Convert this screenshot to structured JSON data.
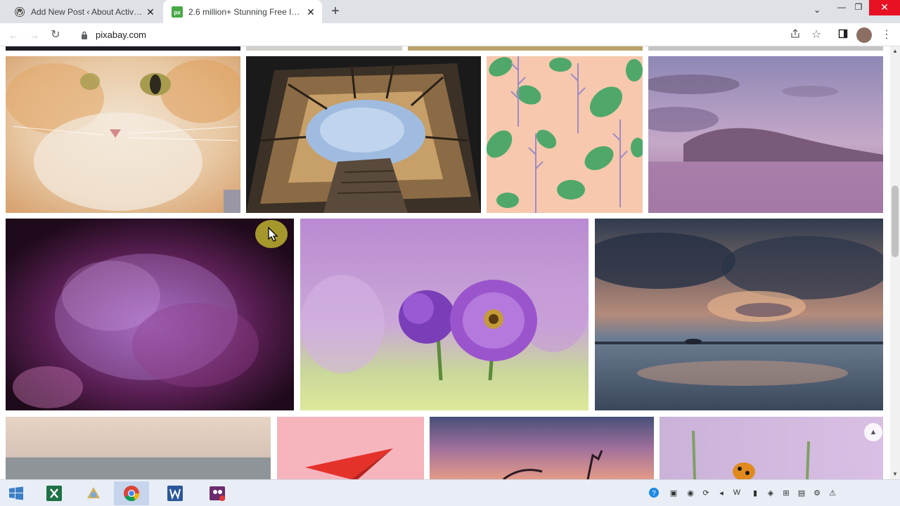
{
  "browser": {
    "tabs": [
      {
        "title": "Add New Post ‹ About Activate",
        "favicon": "wordpress-icon",
        "active": false
      },
      {
        "title": "2.6 million+ Stunning Free Images",
        "favicon": "pixabay-icon",
        "active": true
      }
    ],
    "new_tab_label": "+",
    "address": "pixabay.com"
  },
  "page": {
    "images": [
      {
        "subject": "orange-cat"
      },
      {
        "subject": "courtyard-looking-up"
      },
      {
        "subject": "leaf-pattern"
      },
      {
        "subject": "purple-mountain-sky"
      },
      {
        "subject": "purple-smoke"
      },
      {
        "subject": "purple-flowers"
      },
      {
        "subject": "sunset-sea"
      },
      {
        "subject": "misty-beach"
      },
      {
        "subject": "paper-plane"
      },
      {
        "subject": "sunset-silhouette"
      },
      {
        "subject": "ladybug-flower"
      }
    ]
  },
  "colors": {
    "tab_strip": "#dee1e6",
    "close_button": "#e81123",
    "taskbar": "#e9eef6"
  }
}
